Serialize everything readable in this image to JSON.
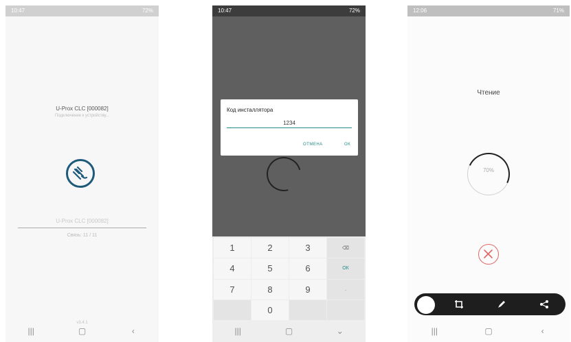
{
  "phone1": {
    "status_time": "10:47",
    "status_right": "72%",
    "device_title": "U-Prox CLC [000082]",
    "device_subtitle": "Подключение к устройству...",
    "device_field_value": "U-Prox CLC [000082]",
    "connection_status": "Связь: 11 / 11",
    "bottom_text": "v3.4.1"
  },
  "phone2": {
    "status_time": "10:47",
    "status_right": "72%",
    "dialog": {
      "title": "Код инсталлятора",
      "input_value": "1234",
      "cancel_label": "ОТМЕНА",
      "ok_label": "ОК"
    },
    "keypad": {
      "keys": [
        "1",
        "2",
        "3",
        "⌫",
        "4",
        "5",
        "6",
        "ОК",
        "7",
        "8",
        "9",
        ".",
        "",
        "0",
        "",
        ""
      ]
    }
  },
  "phone3": {
    "status_time": "12:06",
    "status_right": "71%",
    "title": "Чтение",
    "progress_text": "70%",
    "progress_percent": 70
  },
  "icons": {
    "plug": "plug-icon",
    "cancel": "cancel-icon",
    "crop": "crop-icon",
    "pen": "pen-icon",
    "share": "share-icon"
  },
  "colors": {
    "accent": "#1f8c88",
    "plug": "#1f5a7a",
    "cancel": "#e06666"
  }
}
